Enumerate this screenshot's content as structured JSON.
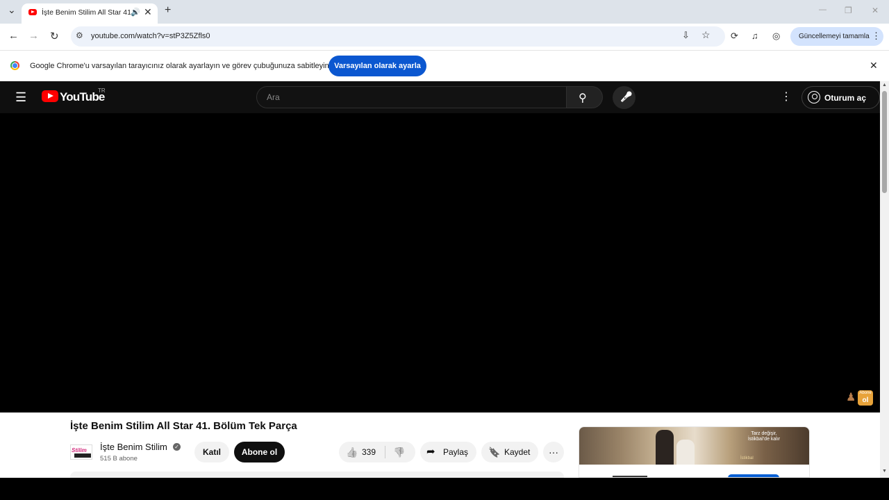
{
  "browser": {
    "tab": {
      "title": "İşte Benim Stilim All Star 41",
      "audio_icon": "🔊",
      "close": "✕"
    },
    "tab_controls": {
      "list": "⌄",
      "new_tab": "+",
      "minimize": "—",
      "maximize": "❐",
      "close": "✕"
    },
    "nav": {
      "back": "←",
      "forward": "→",
      "reload": "↻"
    },
    "omnibox": {
      "url": "youtube.com/watch?v=stP3Z5Zfls0",
      "site_info_icon": "⚙",
      "install_icon": "⇩",
      "bookmark_icon": "☆"
    },
    "toolbar_icons": {
      "extension": "⟳",
      "media": "♫",
      "profile": "◎"
    },
    "update_button": {
      "label": "Güncellemeyi tamamla",
      "menu": "⋮"
    },
    "infobar": {
      "message": "Google Chrome'u varsayılan tarayıcınız olarak ayarlayın ve görev çubuğunuza sabitleyin",
      "button": "Varsayılan olarak ayarla",
      "close": "✕"
    }
  },
  "youtube": {
    "masthead": {
      "menu_icon": "☰",
      "brand": "YouTube",
      "country": "TR",
      "search_placeholder": "Ara",
      "search_icon": "⚲",
      "mic_icon": "🎤",
      "more_icon": "⋮",
      "signin_label": "Oturum aç"
    },
    "player": {
      "watermark_top": "Abone",
      "watermark_main": "ol"
    },
    "video": {
      "title": "İşte Benim Stilim All Star 41. Bölüm Tek Parça",
      "channel": "İşte Benim Stilim",
      "channel_avatar_text": "Stilim",
      "verified": "✓",
      "subscribers": "515 B abone",
      "join": "Katıl",
      "subscribe": "Abone ol",
      "like_icon": "👍",
      "likes": "339",
      "dislike_icon": "👎",
      "share_icon": "➦",
      "share": "Paylaş",
      "save_icon": "🔖",
      "save": "Kaydet",
      "more": "···"
    },
    "ad": {
      "text": "Tarz değişir, İstikbal’de kalır",
      "logo": "İstikbal"
    }
  },
  "scrollbar": {
    "up": "▲",
    "down": "▼"
  }
}
